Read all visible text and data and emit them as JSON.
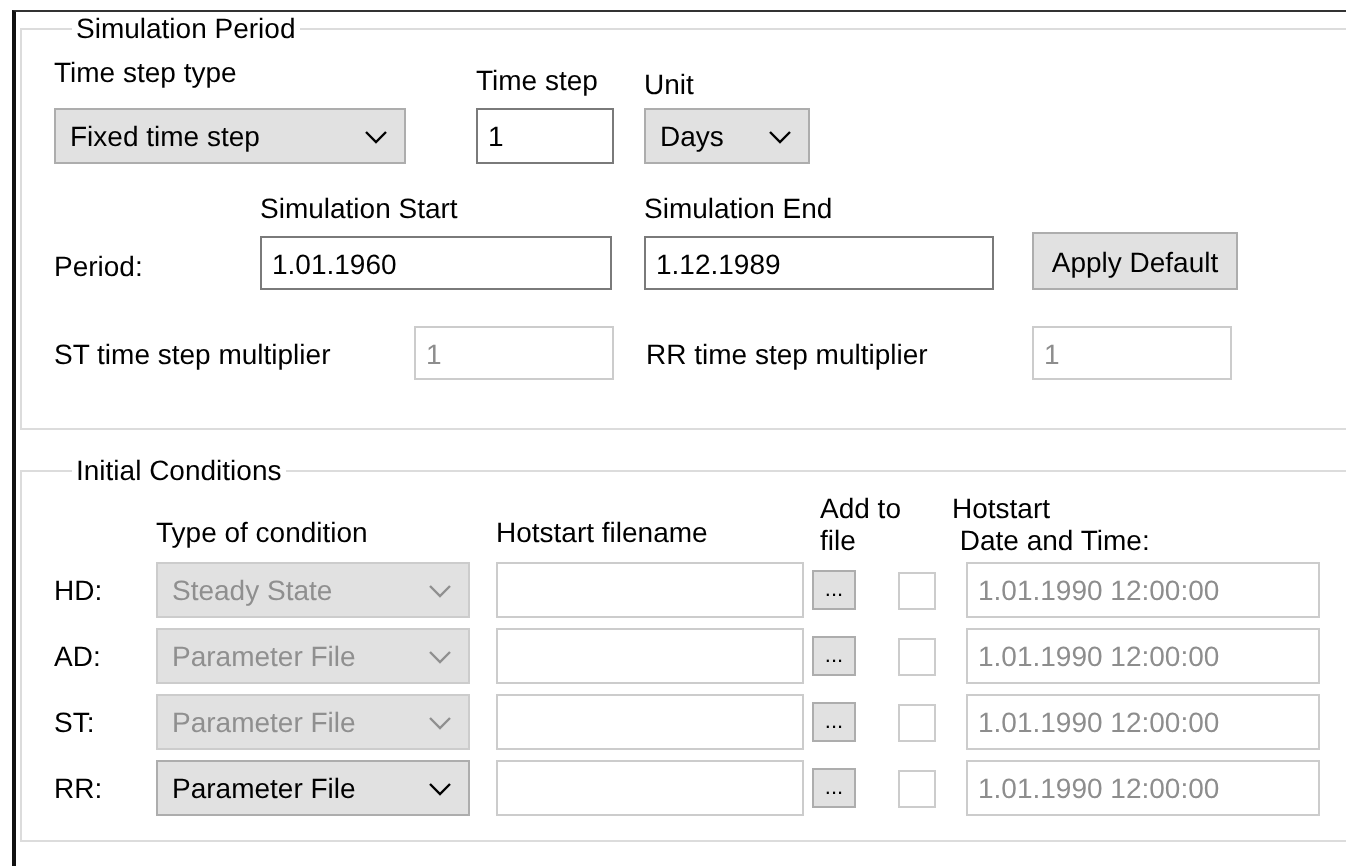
{
  "simulation_period": {
    "title": "Simulation Period",
    "time_step_type": {
      "label": "Time step type",
      "value": "Fixed time step"
    },
    "time_step": {
      "label": "Time step",
      "value": "1"
    },
    "unit": {
      "label": "Unit",
      "value": "Days"
    },
    "period_label": "Period:",
    "start": {
      "label": "Simulation Start",
      "value": "1.01.1960"
    },
    "end": {
      "label": "Simulation End",
      "value": "1.12.1989"
    },
    "apply_button": "Apply Default",
    "multipliers": [
      {
        "label": "ST time step multiplier",
        "value": "1",
        "disabled": true
      },
      {
        "label": "RR time step multiplier",
        "value": "1",
        "disabled": true
      }
    ]
  },
  "initial_conditions": {
    "title": "Initial Conditions",
    "columns": [
      "Type of condition",
      "Hotstart filename",
      "Add to\nfile",
      "Hotstart\n Date and Time:"
    ],
    "rows": [
      {
        "label": "HD:",
        "condition": "Steady State",
        "condition_disabled": true,
        "browse": "...",
        "add_to_file": false,
        "hotstart": "1.01.1990 12:00:00",
        "hotstart_disabled": true
      },
      {
        "label": "AD:",
        "condition": "Parameter File",
        "condition_disabled": true,
        "browse": "...",
        "add_to_file": false,
        "hotstart": "1.01.1990 12:00:00",
        "hotstart_disabled": true
      },
      {
        "label": "ST:",
        "condition": "Parameter File",
        "condition_disabled": true,
        "browse": "...",
        "add_to_file": false,
        "hotstart": "1.01.1990 12:00:00",
        "hotstart_disabled": true
      },
      {
        "label": "RR:",
        "condition": "Parameter File",
        "condition_disabled": false,
        "browse": "...",
        "add_to_file": false,
        "hotstart": "1.01.1990 12:00:00",
        "hotstart_disabled": true
      }
    ]
  }
}
